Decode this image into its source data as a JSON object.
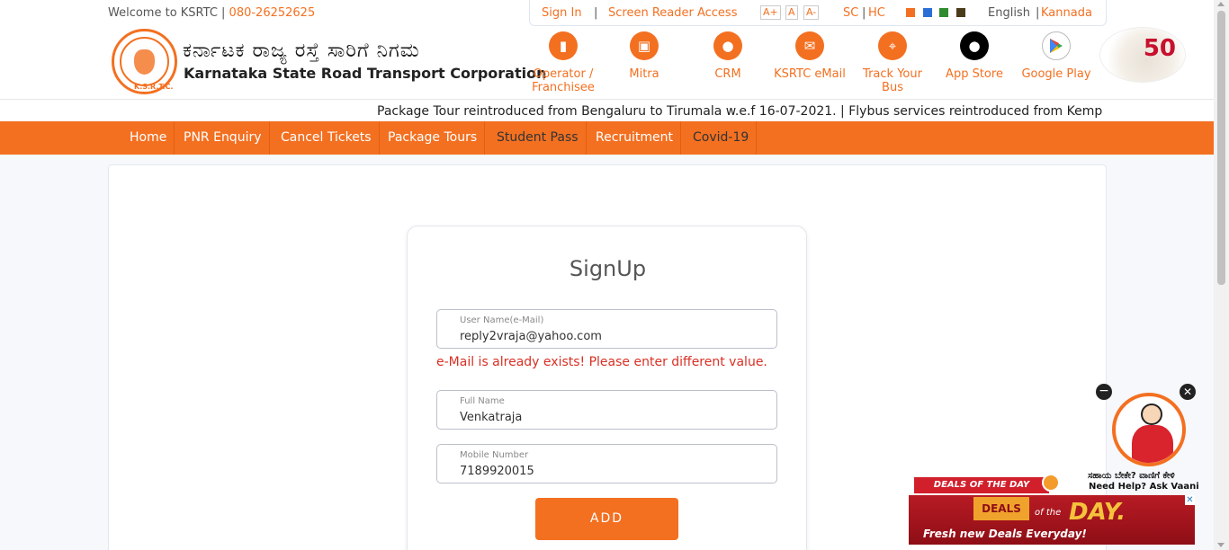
{
  "header": {
    "welcome": "Welcome to KSRTC | ",
    "phone": "080-26252625",
    "org_name_kn": "ಕರ್ನಾಟಕ ರಾಜ್ಯ ರಸ್ತೆ ಸಾರಿಗೆ ನಿಗಮ",
    "org_name_en": "Karnataka State Road Transport Corporation",
    "logo_text": "K. S. R. T. C."
  },
  "topbar": {
    "sign_in": "Sign In",
    "divider": "|",
    "screen_reader": "Screen Reader Access",
    "font_plus": "A+",
    "font_normal": "A",
    "font_minus": "A-",
    "sc": "SC",
    "hc": "HC",
    "bar": "|",
    "theme_colors": [
      "#f37021",
      "#2b6fd6",
      "#2e8b2e",
      "#4a3b1a"
    ],
    "english": "English",
    "kannada": "Kannada"
  },
  "quick_links": [
    {
      "label": "Operator / Franchisee",
      "icon": "building-chart-icon"
    },
    {
      "label": "Mitra",
      "icon": "bus-icon"
    },
    {
      "label": "CRM",
      "icon": "user-icon"
    },
    {
      "label": "KSRTC eMail",
      "icon": "mail-icon"
    },
    {
      "label": "Track Your Bus",
      "icon": "route-pin-icon"
    },
    {
      "label": "App Store",
      "icon": "apple-icon"
    },
    {
      "label": "Google Play",
      "icon": "google-play-icon"
    }
  ],
  "ticker": "Package Tour reintroduced from Bengaluru to Tirumala w.e.f 16-07-2021. | Flybus services reintroduced from Kemp",
  "nav": [
    "Home",
    "PNR Enquiry",
    "Cancel Tickets",
    "Package Tours",
    "Student Pass",
    "Recruitment",
    "Covid-19"
  ],
  "signup": {
    "title": "SignUp",
    "username_label": "User Name(e-Mail)",
    "username_value": "reply2vraja@yahoo.com",
    "error": "e-Mail is already exists! Please enter different value.",
    "fullname_label": "Full Name",
    "fullname_value": "Venkatraja",
    "mobile_label": "Mobile Number",
    "mobile_value": "7189920015",
    "add_button": "ADD"
  },
  "vaani": {
    "kn_text": "ಸಹಾಯ ಬೇಕೇ? ವಾಣಿಗೆ ಕೇಳಿ",
    "en_text": "Need Help? Ask Vaani"
  },
  "ad": {
    "ribbon": "DEALS OF THE DAY",
    "deals": "DEALS",
    "of_the": "of the",
    "day": "DAY.",
    "tagline": "Fresh new Deals Everyday!"
  }
}
